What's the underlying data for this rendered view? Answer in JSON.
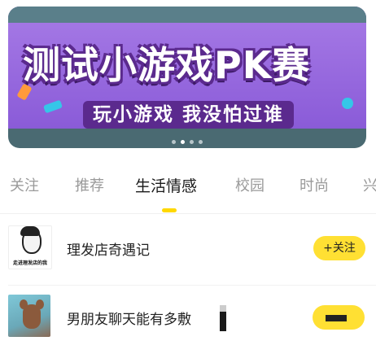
{
  "banner": {
    "title": "测试小游戏PK赛",
    "subtitle": "玩小游戏 我没怕过谁",
    "page_count": 4,
    "active_page": 2
  },
  "tabs": [
    {
      "label": "关注"
    },
    {
      "label": "推荐"
    },
    {
      "label": "生活情感",
      "active": true
    },
    {
      "label": "校园"
    },
    {
      "label": "时尚"
    },
    {
      "label": "兴"
    }
  ],
  "list": [
    {
      "title": "理发店奇遇记",
      "thumb_caption": "走进理发店的我",
      "follow_label": "+关注"
    },
    {
      "title": "男朋友聊天能有多敷",
      "thumb_caption": "",
      "follow_label": ""
    }
  ],
  "colors": {
    "accent": "#ffe033",
    "tab_indicator": "#ffd800",
    "banner_purple": "#8a5bd8"
  }
}
